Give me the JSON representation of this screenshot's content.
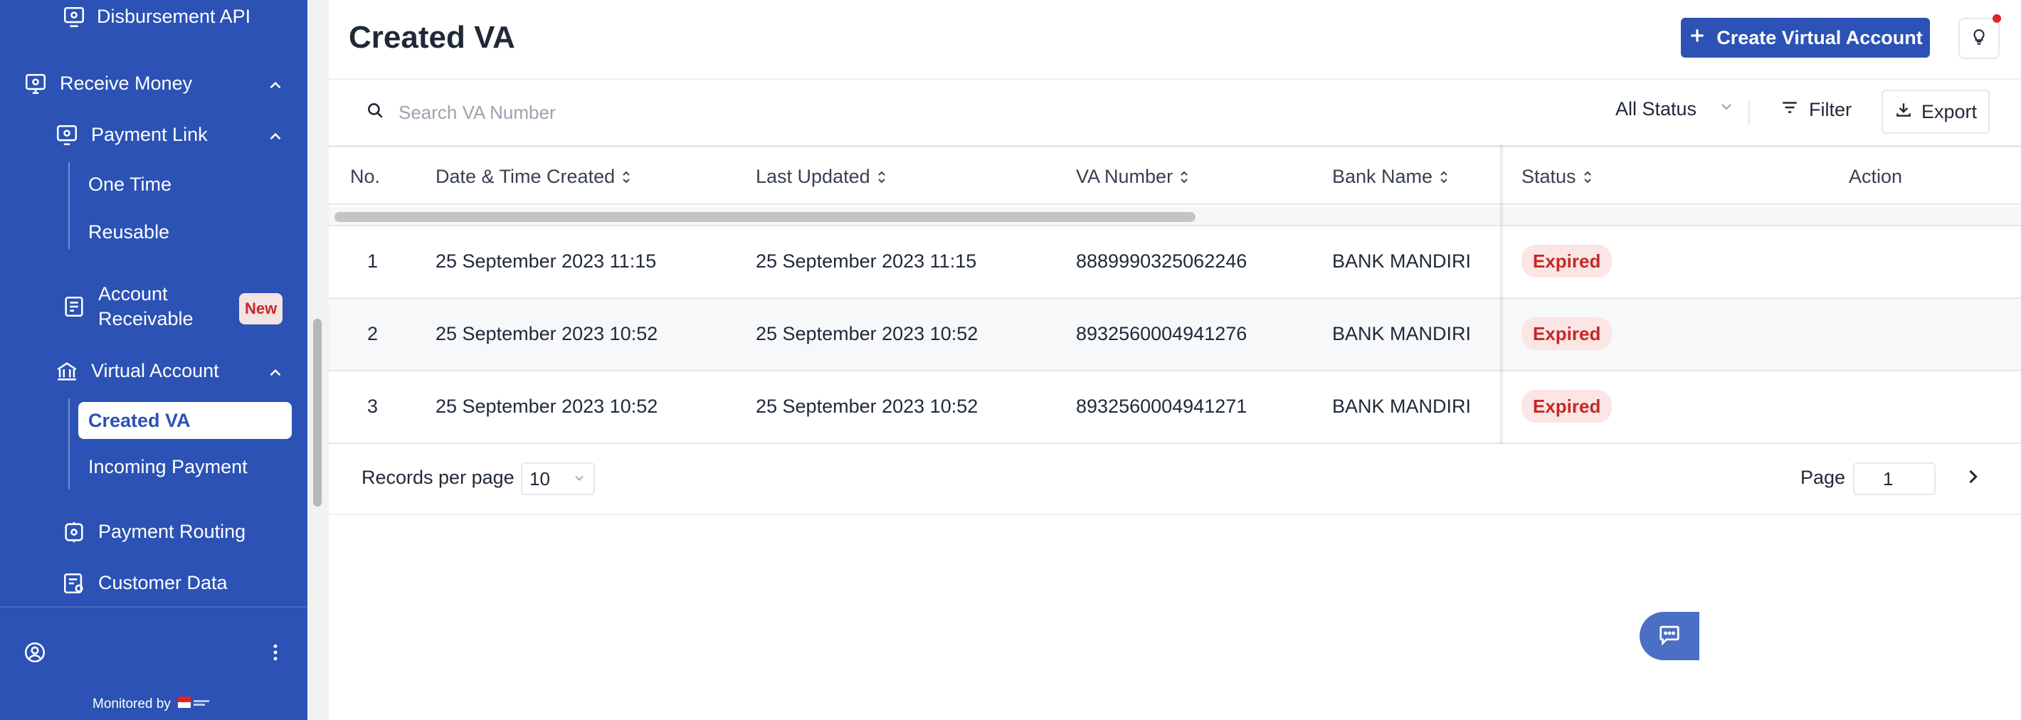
{
  "sidebar": {
    "disbursement_api": "Disbursement API",
    "receive_money": "Receive Money",
    "payment_link": "Payment Link",
    "one_time": "One Time",
    "reusable": "Reusable",
    "account_receivable_line1": "Account",
    "account_receivable_line2": "Receivable",
    "new_badge": "New",
    "virtual_account": "Virtual Account",
    "created_va": "Created VA",
    "incoming_payment": "Incoming Payment",
    "payment_routing": "Payment Routing",
    "customer_data": "Customer Data",
    "monitored_by": "Monitored by"
  },
  "header": {
    "title": "Created VA",
    "create_button": "Create Virtual Account"
  },
  "toolbar": {
    "search_placeholder": "Search VA Number",
    "status_filter": "All Status",
    "filter_label": "Filter",
    "export_label": "Export"
  },
  "table": {
    "columns": [
      "No.",
      "Date & Time Created",
      "Last Updated",
      "VA Number",
      "Bank Name",
      "Status",
      "Action"
    ],
    "rows": [
      {
        "no": "1",
        "created": "25 September 2023 11:15",
        "updated": "25 September 2023 11:15",
        "va_number": "8889990325062246",
        "bank": "BANK MANDIRI",
        "status": "Expired"
      },
      {
        "no": "2",
        "created": "25 September 2023 10:52",
        "updated": "25 September 2023 10:52",
        "va_number": "8932560004941276",
        "bank": "BANK MANDIRI",
        "status": "Expired"
      },
      {
        "no": "3",
        "created": "25 September 2023 10:52",
        "updated": "25 September 2023 10:52",
        "va_number": "8932560004941271",
        "bank": "BANK MANDIRI",
        "status": "Expired"
      }
    ]
  },
  "pagination": {
    "records_label": "Records per page",
    "records_value": "10",
    "page_label": "Page",
    "page_value": "1"
  },
  "colors": {
    "sidebar_bg": "#2b52b4",
    "primary": "#2b52b4",
    "expired_text": "#c62828",
    "expired_bg": "#fbe5e5"
  },
  "icons": [
    "gear-monitor-icon",
    "monitor-money-icon",
    "chevron-up-icon",
    "invoice-icon",
    "bank-icon",
    "user-circle-icon",
    "more-vertical-icon",
    "plus-icon",
    "lightbulb-icon",
    "search-icon",
    "chevron-down-icon",
    "filter-icon",
    "download-icon",
    "sort-icon",
    "chevron-right-icon",
    "chat-icon"
  ]
}
